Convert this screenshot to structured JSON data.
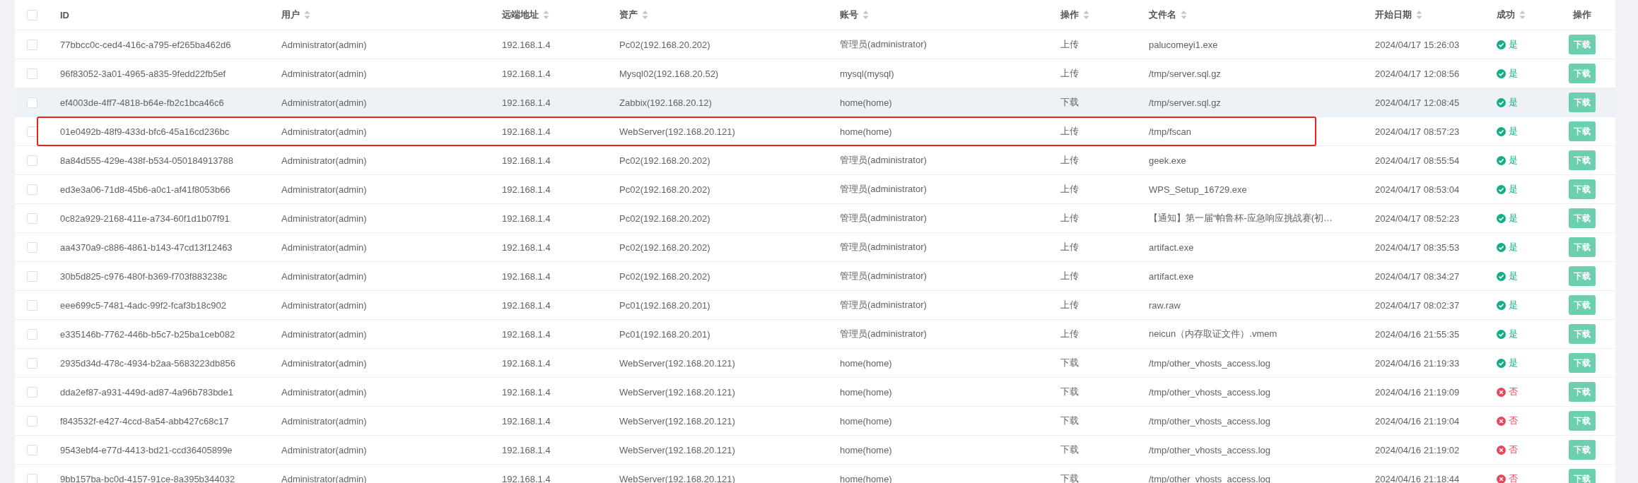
{
  "table": {
    "select_all_checked": false,
    "columns": [
      {
        "label": "ID",
        "sortable": false
      },
      {
        "label": "用户",
        "sortable": true
      },
      {
        "label": "远端地址",
        "sortable": true
      },
      {
        "label": "资产",
        "sortable": true
      },
      {
        "label": "账号",
        "sortable": true
      },
      {
        "label": "操作",
        "sortable": true
      },
      {
        "label": "文件名",
        "sortable": true
      },
      {
        "label": "开始日期",
        "sortable": true
      },
      {
        "label": "成功",
        "sortable": true
      },
      {
        "label": "操作",
        "sortable": false
      }
    ],
    "rows": [
      {
        "checked": false,
        "hovered": false,
        "highlighted": false,
        "id": "77bbcc0c-ced4-416c-a795-ef265ba462d6",
        "user": "Administrator(admin)",
        "remote": "192.168.1.4",
        "asset": "Pc02(192.168.20.202)",
        "account": "管理员(administrator)",
        "operation": "上传",
        "file": "palucomeyi1.exe",
        "date": "2024/04/17 15:26:03",
        "success": true,
        "result": "是",
        "action": "下载"
      },
      {
        "checked": false,
        "hovered": false,
        "highlighted": false,
        "id": "96f83052-3a01-4965-a835-9fedd22fb5ef",
        "user": "Administrator(admin)",
        "remote": "192.168.1.4",
        "asset": "Mysql02(192.168.20.52)",
        "account": "mysql(mysql)",
        "operation": "上传",
        "file": "/tmp/server.sql.gz",
        "date": "2024/04/17 12:08:56",
        "success": true,
        "result": "是",
        "action": "下载"
      },
      {
        "checked": false,
        "hovered": true,
        "highlighted": false,
        "id": "ef4003de-4ff7-4818-b64e-fb2c1bca46c6",
        "user": "Administrator(admin)",
        "remote": "192.168.1.4",
        "asset": "Zabbix(192.168.20.12)",
        "account": "home(home)",
        "operation": "下载",
        "file": "/tmp/server.sql.gz",
        "date": "2024/04/17 12:08:45",
        "success": true,
        "result": "是",
        "action": "下载"
      },
      {
        "checked": false,
        "hovered": false,
        "highlighted": true,
        "id": "01e0492b-48f9-433d-bfc6-45a16cd236bc",
        "user": "Administrator(admin)",
        "remote": "192.168.1.4",
        "asset": "WebServer(192.168.20.121)",
        "account": "home(home)",
        "operation": "上传",
        "file": "/tmp/fscan",
        "date": "2024/04/17 08:57:23",
        "success": true,
        "result": "是",
        "action": "下载"
      },
      {
        "checked": false,
        "hovered": false,
        "highlighted": false,
        "id": "8a84d555-429e-438f-b534-050184913788",
        "user": "Administrator(admin)",
        "remote": "192.168.1.4",
        "asset": "Pc02(192.168.20.202)",
        "account": "管理员(administrator)",
        "operation": "上传",
        "file": "geek.exe",
        "date": "2024/04/17 08:55:54",
        "success": true,
        "result": "是",
        "action": "下载"
      },
      {
        "checked": false,
        "hovered": false,
        "highlighted": false,
        "id": "ed3e3a06-71d8-45b6-a0c1-af41f8053b66",
        "user": "Administrator(admin)",
        "remote": "192.168.1.4",
        "asset": "Pc02(192.168.20.202)",
        "account": "管理员(administrator)",
        "operation": "上传",
        "file": "WPS_Setup_16729.exe",
        "date": "2024/04/17 08:53:04",
        "success": true,
        "result": "是",
        "action": "下载"
      },
      {
        "checked": false,
        "hovered": false,
        "highlighted": false,
        "id": "0c82a929-2168-411e-a734-60f1d1b07f91",
        "user": "Administrator(admin)",
        "remote": "192.168.1.4",
        "asset": "Pc02(192.168.20.202)",
        "account": "管理员(administrator)",
        "operation": "上传",
        "file": "【通知】第一届“帕鲁杯-应急响应挑战赛(初…",
        "date": "2024/04/17 08:52:23",
        "success": true,
        "result": "是",
        "action": "下载"
      },
      {
        "checked": false,
        "hovered": false,
        "highlighted": false,
        "id": "aa4370a9-c886-4861-b143-47cd13f12463",
        "user": "Administrator(admin)",
        "remote": "192.168.1.4",
        "asset": "Pc02(192.168.20.202)",
        "account": "管理员(administrator)",
        "operation": "上传",
        "file": "artifact.exe",
        "date": "2024/04/17 08:35:53",
        "success": true,
        "result": "是",
        "action": "下载"
      },
      {
        "checked": false,
        "hovered": false,
        "highlighted": false,
        "id": "30b5d825-c976-480f-b369-f703f883238c",
        "user": "Administrator(admin)",
        "remote": "192.168.1.4",
        "asset": "Pc02(192.168.20.202)",
        "account": "管理员(administrator)",
        "operation": "上传",
        "file": "artifact.exe",
        "date": "2024/04/17 08:34:27",
        "success": true,
        "result": "是",
        "action": "下载"
      },
      {
        "checked": false,
        "hovered": false,
        "highlighted": false,
        "id": "eee699c5-7481-4adc-99f2-fcaf3b18c902",
        "user": "Administrator(admin)",
        "remote": "192.168.1.4",
        "asset": "Pc01(192.168.20.201)",
        "account": "管理员(administrator)",
        "operation": "上传",
        "file": "raw.raw",
        "date": "2024/04/17 08:02:37",
        "success": true,
        "result": "是",
        "action": "下载"
      },
      {
        "checked": false,
        "hovered": false,
        "highlighted": false,
        "id": "e335146b-7762-446b-b5c7-b25ba1ceb082",
        "user": "Administrator(admin)",
        "remote": "192.168.1.4",
        "asset": "Pc01(192.168.20.201)",
        "account": "管理员(administrator)",
        "operation": "上传",
        "file": "neicun（内存取证文件）.vmem",
        "date": "2024/04/16 21:55:35",
        "success": true,
        "result": "是",
        "action": "下载"
      },
      {
        "checked": false,
        "hovered": false,
        "highlighted": false,
        "id": "2935d34d-478c-4934-b2aa-5683223db856",
        "user": "Administrator(admin)",
        "remote": "192.168.1.4",
        "asset": "WebServer(192.168.20.121)",
        "account": "home(home)",
        "operation": "下载",
        "file": "/tmp/other_vhosts_access.log",
        "date": "2024/04/16 21:19:33",
        "success": true,
        "result": "是",
        "action": "下载"
      },
      {
        "checked": false,
        "hovered": false,
        "highlighted": false,
        "id": "dda2ef87-a931-449d-ad87-4a96b783bde1",
        "user": "Administrator(admin)",
        "remote": "192.168.1.4",
        "asset": "WebServer(192.168.20.121)",
        "account": "home(home)",
        "operation": "下载",
        "file": "/tmp/other_vhosts_access.log",
        "date": "2024/04/16 21:19:09",
        "success": false,
        "result": "否",
        "action": "下载"
      },
      {
        "checked": false,
        "hovered": false,
        "highlighted": false,
        "id": "f843532f-e427-4ccd-8a54-abb427c68c17",
        "user": "Administrator(admin)",
        "remote": "192.168.1.4",
        "asset": "WebServer(192.168.20.121)",
        "account": "home(home)",
        "operation": "下载",
        "file": "/tmp/other_vhosts_access.log",
        "date": "2024/04/16 21:19:04",
        "success": false,
        "result": "否",
        "action": "下载"
      },
      {
        "checked": false,
        "hovered": false,
        "highlighted": false,
        "id": "9543ebf4-e77d-4413-bd21-ccd36405899e",
        "user": "Administrator(admin)",
        "remote": "192.168.1.4",
        "asset": "WebServer(192.168.20.121)",
        "account": "home(home)",
        "operation": "下载",
        "file": "/tmp/other_vhosts_access.log",
        "date": "2024/04/16 21:19:02",
        "success": false,
        "result": "否",
        "action": "下载"
      },
      {
        "checked": false,
        "hovered": false,
        "highlighted": false,
        "id": "9bb157ba-bc0d-4157-91ce-8a395b344032",
        "user": "Administrator(admin)",
        "remote": "192.168.1.4",
        "asset": "WebServer(192.168.20.121)",
        "account": "home(home)",
        "operation": "下载",
        "file": "/tmp/other_vhosts_access.log",
        "date": "2024/04/16 21:18:44",
        "success": false,
        "result": "否",
        "action": "下载"
      }
    ]
  }
}
